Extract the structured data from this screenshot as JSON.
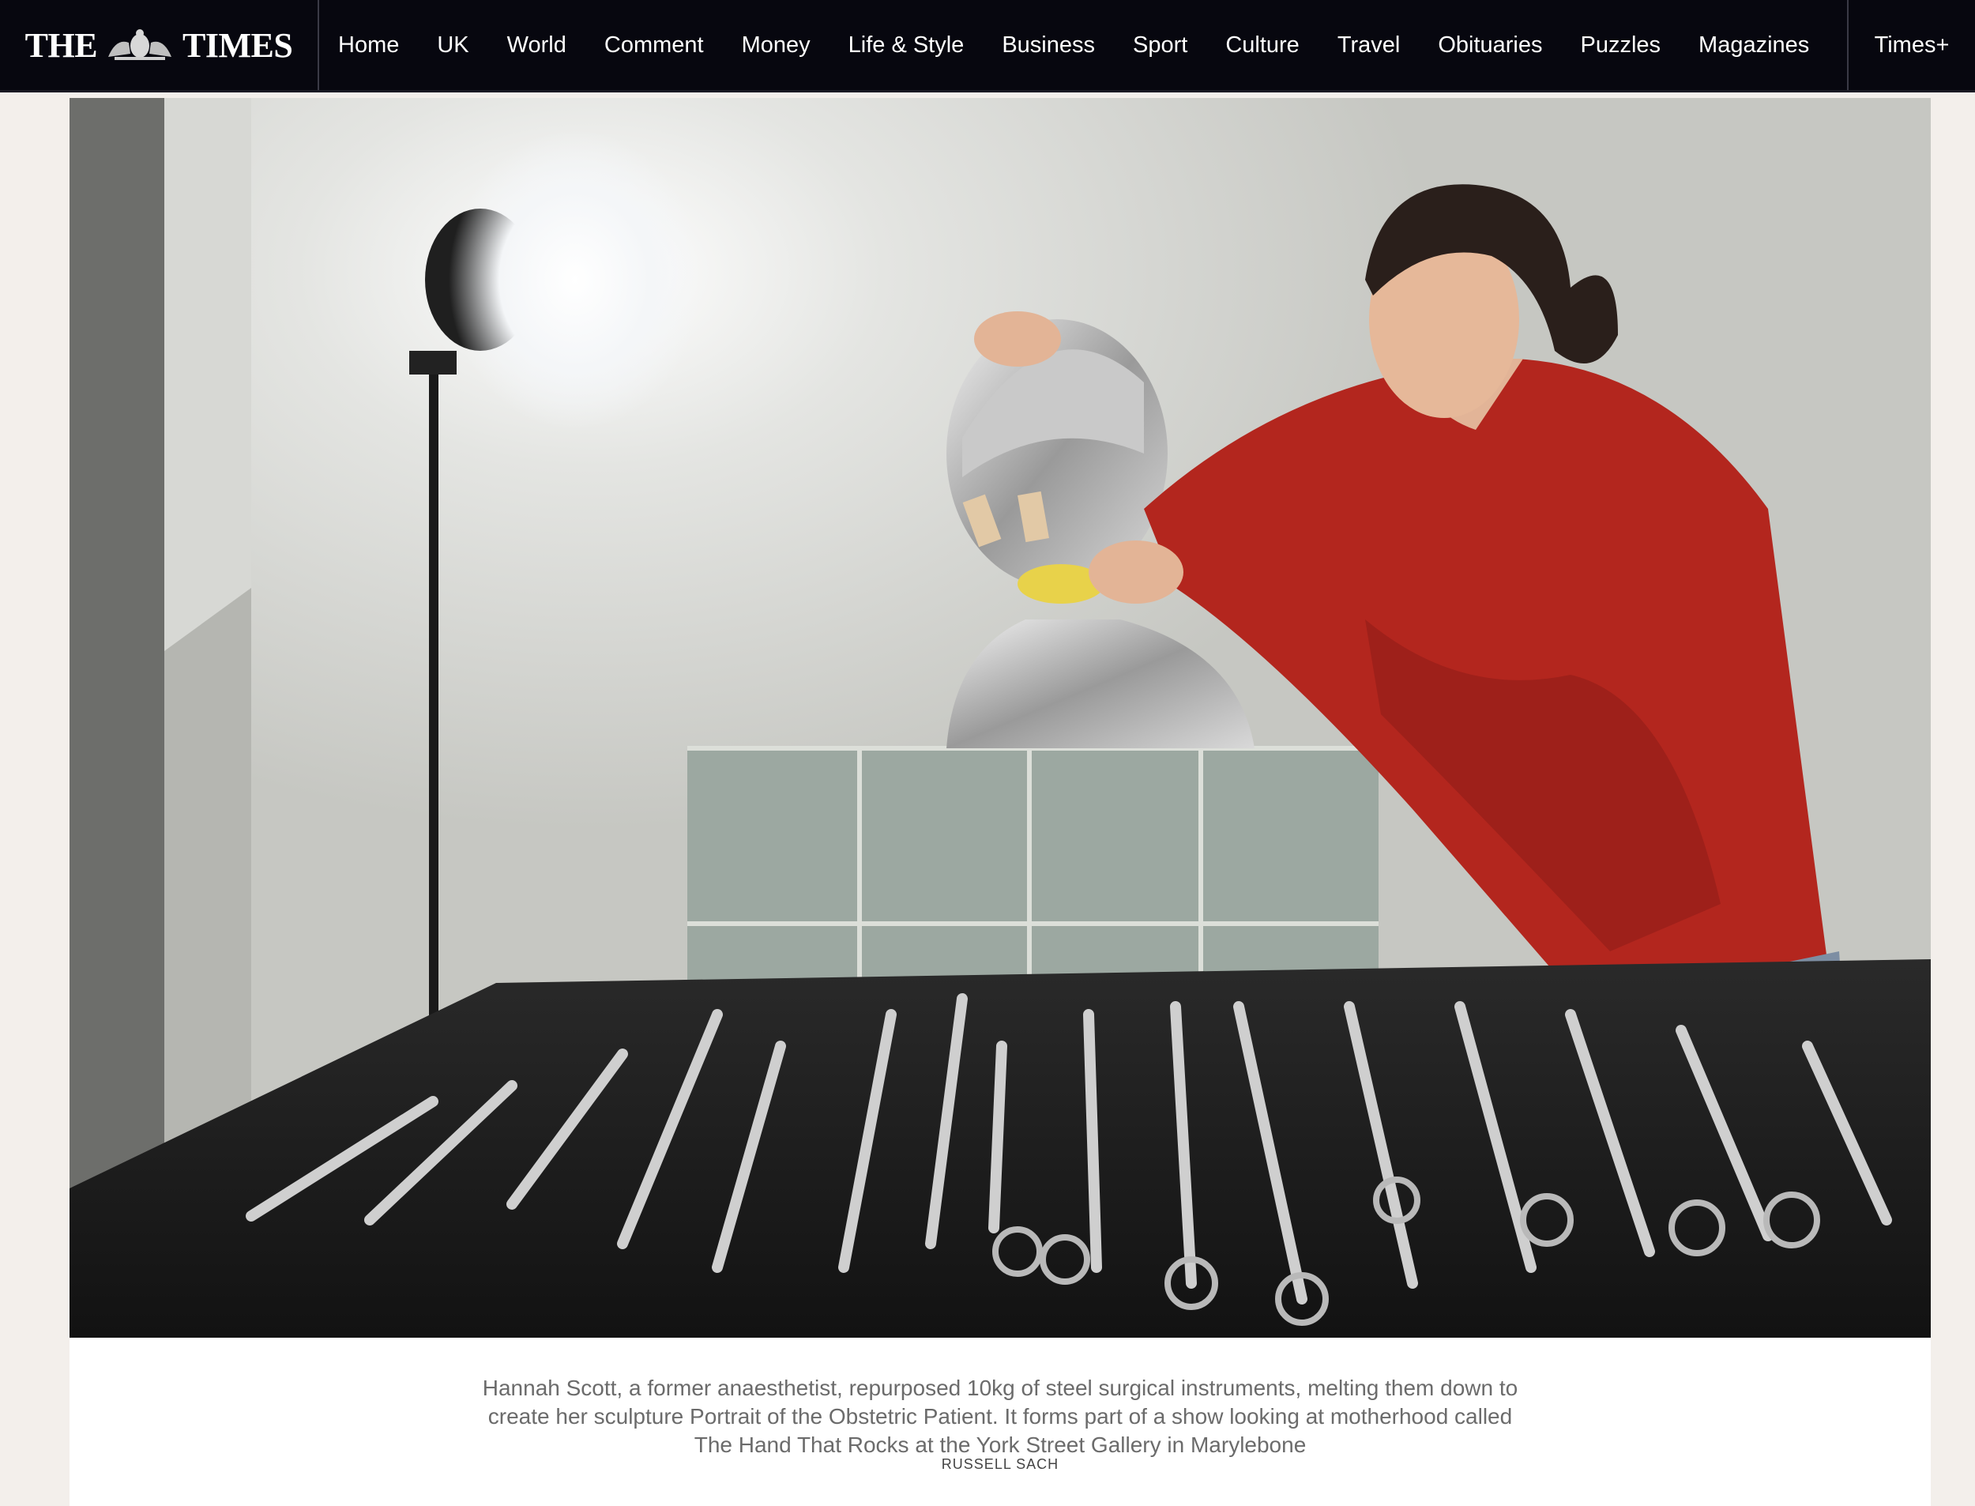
{
  "header": {
    "logo_left": "THE",
    "logo_right": "TIMES",
    "nav": [
      "Home",
      "UK",
      "World",
      "Comment",
      "Money",
      "Life & Style",
      "Business",
      "Sport",
      "Culture",
      "Travel",
      "Obituaries",
      "Puzzles",
      "Magazines"
    ],
    "times_plus": "Times+"
  },
  "article": {
    "caption": "Hannah Scott, a former anaesthetist, repurposed 10kg of steel surgical instruments, melting them down to create her sculpture Portrait of the Obstetric Patient. It forms part of a show looking at motherhood called The Hand That Rocks at the York Street Gallery in Marylebone",
    "credit": "RUSSELL SACH"
  },
  "colors": {
    "nav_background": "#07070f",
    "page_background": "#f3efeb",
    "caption_text": "#6b6b6b"
  }
}
